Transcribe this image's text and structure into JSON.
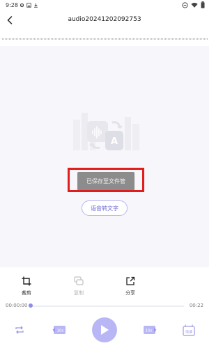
{
  "status_bar": {
    "time": "9:28"
  },
  "header": {
    "title": "audio20241202092753"
  },
  "toast": {
    "text": "已保存至文件管"
  },
  "convert_button": {
    "label": "语音转文字"
  },
  "actions": [
    {
      "label": "裁剪",
      "icon": "crop-icon"
    },
    {
      "label": "复制",
      "icon": "copy-icon"
    },
    {
      "label": "分享",
      "icon": "share-icon"
    }
  ],
  "playback": {
    "current_time": "00:00:00",
    "duration": "00:22",
    "progress": 0.0
  },
  "controls": {
    "rewind_label": "10s",
    "forward_label": "10s",
    "speed_label": "倍速"
  },
  "colors": {
    "accent": "#8f8bea",
    "play_button": "#b9b6f5",
    "highlight_box": "#e11d1d"
  }
}
